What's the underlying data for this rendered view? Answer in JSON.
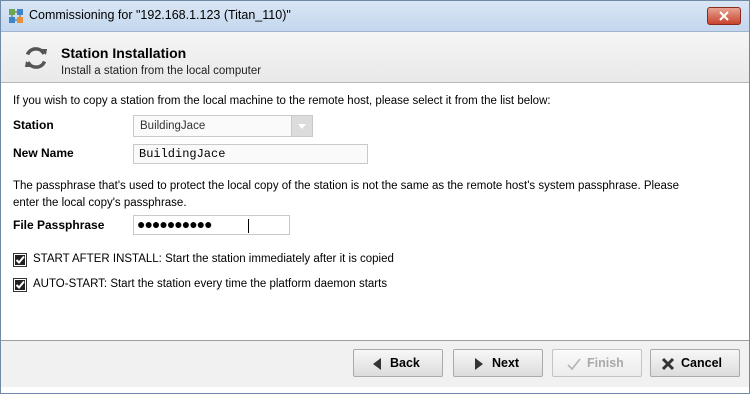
{
  "window": {
    "title": "Commissioning for \"192.168.1.123 (Titan_110)\""
  },
  "header": {
    "title": "Station Installation",
    "subtitle": "Install a station from the local computer"
  },
  "main": {
    "intro": "If you wish to copy a station from the local machine to the remote host, please select it from the list below:",
    "station_label": "Station",
    "station_value": "BuildingJace",
    "new_name_label": "New Name",
    "new_name_value": "BuildingJace",
    "passphrase_note_line1": "The passphrase that's used to protect the local copy of the station is not the same as the remote host's system passphrase. Please",
    "passphrase_note_line2": "enter the local copy's passphrase.",
    "file_passphrase_label": "File Passphrase",
    "file_passphrase_masked": "●●●●●●●●●●",
    "start_after_install_label": "START AFTER INSTALL: Start the station immediately after it is copied",
    "start_after_install_checked": true,
    "auto_start_label": "AUTO-START: Start the station every time the platform daemon starts",
    "auto_start_checked": true
  },
  "buttons": {
    "back": "Back",
    "next": "Next",
    "finish": "Finish",
    "cancel": "Cancel"
  },
  "icons": {
    "app": "network-app-icon",
    "header": "refresh-icon",
    "back": "triangle-left-icon",
    "next": "triangle-right-icon",
    "finish": "check-icon",
    "cancel": "x-icon"
  }
}
